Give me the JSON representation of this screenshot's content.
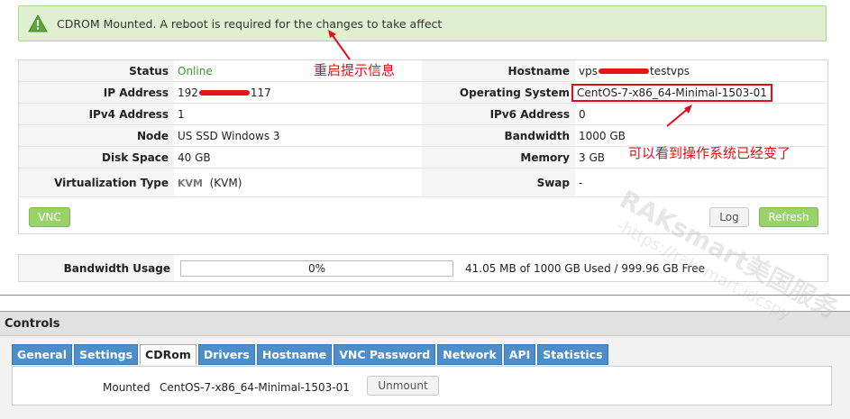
{
  "alert": {
    "message": "CDROM Mounted. A reboot is required for the changes to take affect"
  },
  "info": {
    "left": [
      {
        "label": "Status",
        "value": "Online"
      },
      {
        "label": "IP Address",
        "value_pre": "192",
        "value_post": "117"
      },
      {
        "label": "IPv4 Address",
        "value": "1"
      },
      {
        "label": "Node",
        "value": "US SSD Windows 3"
      },
      {
        "label": "Disk Space",
        "value": "40 GB"
      },
      {
        "label": "Virtualization Type",
        "value": "KVM",
        "value_suffix": "(KVM)"
      }
    ],
    "right": [
      {
        "label": "Hostname",
        "value_pre": "vps",
        "value_post": "testvps"
      },
      {
        "label": "Operating System",
        "value": "CentOS-7-x86_64-Minimal-1503-01"
      },
      {
        "label": "IPv6 Address",
        "value": "0"
      },
      {
        "label": "Bandwidth",
        "value": "1000 GB"
      },
      {
        "label": "Memory",
        "value": "3 GB"
      },
      {
        "label": "Swap",
        "value": "-"
      }
    ]
  },
  "buttons": {
    "vnc": "VNC",
    "log": "Log",
    "refresh": "Refresh",
    "unmount": "Unmount"
  },
  "bandwidth": {
    "label": "Bandwidth Usage",
    "percent_text": "0%",
    "percent": 0,
    "summary": "41.05 MB of 1000 GB Used / 999.96 GB Free"
  },
  "controls": {
    "title": "Controls",
    "tabs": [
      "General",
      "Settings",
      "CDRom",
      "Drivers",
      "Hostname",
      "VNC Password",
      "Network",
      "API",
      "Statistics"
    ],
    "active_tab": "CDRom",
    "mounted_label": "Mounted",
    "mounted_value": "CentOS-7-x86_64-Minimal-1503-01"
  },
  "annotations": {
    "reboot_note": "重启提示信息",
    "os_note": "可以看到操作系统已经变了"
  },
  "watermark": {
    "brand": "RAKsmart美国服务",
    "url": "-https://raksmart.idcspy"
  },
  "colors": {
    "online": "#3a9a25",
    "annotation": "#e30d16",
    "tab": "#4d8ec9",
    "green_button": "#9ad26a"
  }
}
